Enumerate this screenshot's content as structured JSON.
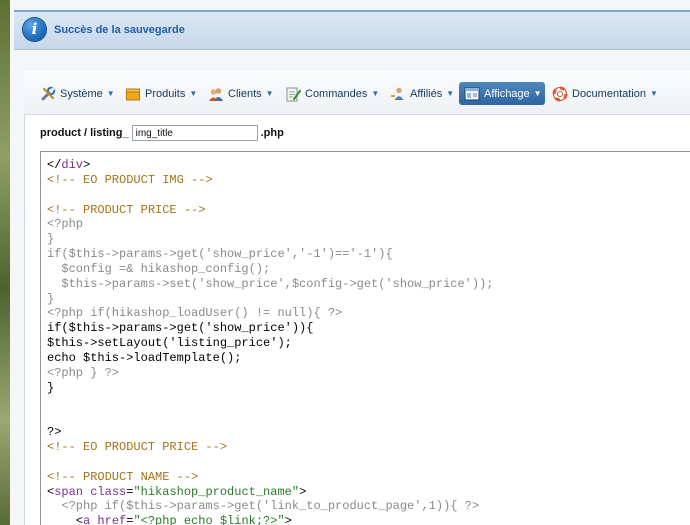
{
  "message": {
    "icon": "info-icon",
    "text": "Succès de la sauvegarde"
  },
  "menu": {
    "items": [
      {
        "label": "Système",
        "icon": "tools-icon"
      },
      {
        "label": "Produits",
        "icon": "box-icon"
      },
      {
        "label": "Clients",
        "icon": "users-icon"
      },
      {
        "label": "Commandes",
        "icon": "document-pen-icon"
      },
      {
        "label": "Affiliés",
        "icon": "affiliates-icon"
      },
      {
        "label": "Affichage",
        "icon": "display-icon",
        "active": true
      },
      {
        "label": "Documentation",
        "icon": "lifebuoy-icon"
      }
    ]
  },
  "file": {
    "prefix": "product / listing_",
    "name_value": "img_title",
    "suffix": ".php"
  },
  "code_lines": [
    {
      "t": "plain",
      "s": "</"
    },
    {
      "t": "comment",
      "s": "<!-- EO PRODUCT IMG -->"
    },
    {
      "t": "blank",
      "s": ""
    },
    {
      "t": "comment",
      "s": "<!-- PRODUCT PRICE -->"
    },
    {
      "t": "php",
      "s": "<?php"
    },
    {
      "t": "php",
      "s": "}"
    },
    {
      "t": "php",
      "s": "if($this->params->get('show_price','-1')=='-1'){"
    },
    {
      "t": "php",
      "s": "  $config =& hikashop_config();"
    },
    {
      "t": "php",
      "s": "  $this->params->set('show_price',$config->get('show_price'));"
    },
    {
      "t": "php",
      "s": "}"
    },
    {
      "t": "php",
      "s": "<?php if(hikashop_loadUser() != null){ ?>"
    },
    {
      "t": "plain",
      "s": "if($this->params->get('show_price')){"
    },
    {
      "t": "plain",
      "s": "$this->setLayout('listing_price');"
    },
    {
      "t": "plain",
      "s": "echo $this->loadTemplate();"
    },
    {
      "t": "php",
      "s": "<?php } ?>"
    },
    {
      "t": "plain",
      "s": "}"
    },
    {
      "t": "blank",
      "s": ""
    },
    {
      "t": "blank",
      "s": ""
    },
    {
      "t": "plain",
      "s": "?>"
    },
    {
      "t": "comment",
      "s": "<!-- EO PRODUCT PRICE -->"
    },
    {
      "t": "blank",
      "s": ""
    },
    {
      "t": "comment",
      "s": "<!-- PRODUCT NAME -->"
    },
    {
      "t": "plain",
      "s": "<span class=\"hikashop_product_name\">"
    },
    {
      "t": "php",
      "s": "  <?php if($this->params->get('link_to_product_page',1)){ ?>"
    },
    {
      "t": "plain",
      "s": "    <a href=\"<?php echo $link;?>\">"
    }
  ],
  "colors": {
    "accent": "#2e64a0",
    "message_text": "#1d5fa6",
    "comment": "#a6721a",
    "php": "#8a8a8a",
    "tag": "#7a2d8f",
    "string": "#2a7a2a"
  }
}
